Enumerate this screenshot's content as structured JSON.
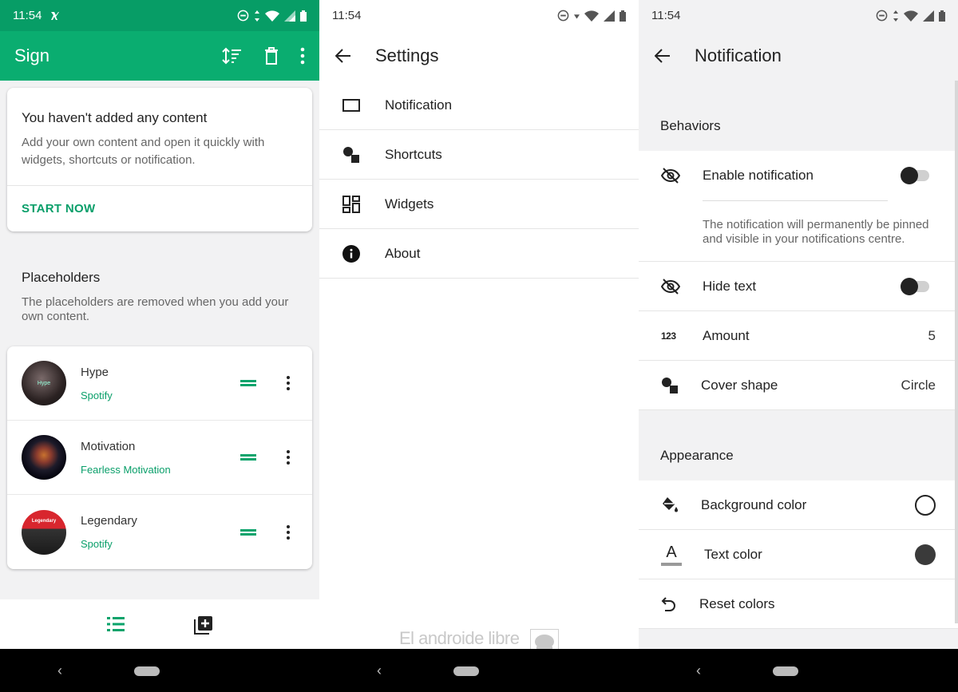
{
  "status": {
    "time": "11:54"
  },
  "screen1": {
    "title": "Sign",
    "empty_card": {
      "heading": "You haven't added any content",
      "body": "Add your own content and open it quickly with widgets, shortcuts or notification.",
      "action": "START NOW"
    },
    "placeholders": {
      "heading": "Placeholders",
      "body": "The placeholders are removed when you add your own content."
    },
    "items": [
      {
        "title": "Hype",
        "subtitle": "Spotify",
        "avatar_text": "Hype"
      },
      {
        "title": "Motivation",
        "subtitle": "Fearless Motivation",
        "avatar_text": ""
      },
      {
        "title": "Legendary",
        "subtitle": "Spotify",
        "avatar_text": "Legendary"
      }
    ]
  },
  "screen2": {
    "title": "Settings",
    "items": [
      {
        "label": "Notification",
        "icon": "rectangle-icon"
      },
      {
        "label": "Shortcuts",
        "icon": "shapes-icon"
      },
      {
        "label": "Widgets",
        "icon": "widgets-icon"
      },
      {
        "label": "About",
        "icon": "info-icon"
      }
    ],
    "watermark": "El androide libre"
  },
  "screen3": {
    "title": "Notification",
    "behaviors": "Behaviors",
    "enable_notification": "Enable notification",
    "enable_desc": "The notification will permanently be pinned and visible in your notifications centre.",
    "hide_text": "Hide text",
    "amount": {
      "label": "Amount",
      "value": "5",
      "icon_text": "123"
    },
    "cover_shape": {
      "label": "Cover shape",
      "value": "Circle"
    },
    "appearance": "Appearance",
    "background_color": "Background color",
    "text_color": "Text color",
    "text_icon_letter": "A",
    "reset_colors": "Reset colors"
  },
  "colors": {
    "accent": "#0aad70",
    "status_green": "#079d66",
    "link_green": "#0a9f6a"
  }
}
